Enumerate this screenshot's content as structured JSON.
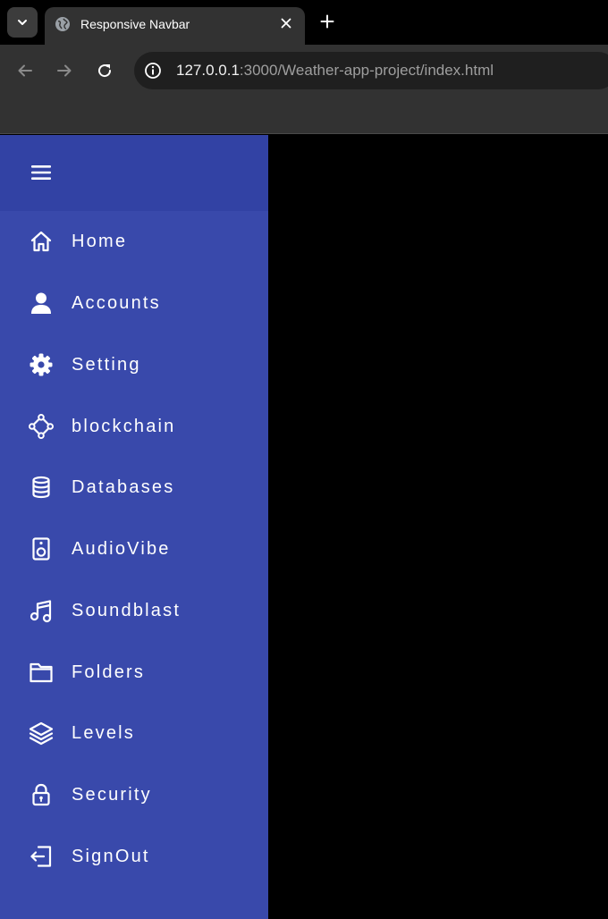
{
  "browser": {
    "tab": {
      "title": "Responsive Navbar",
      "favicon": "globe-icon"
    },
    "address_bar": {
      "host": "127.0.0.1",
      "rest": ":3000/Weather-app-project/index.html"
    },
    "icons": {
      "tab_search": "chevron-down-icon",
      "close_tab": "close-icon",
      "new_tab": "plus-icon",
      "back": "arrow-left-icon",
      "forward": "arrow-right-icon",
      "reload": "reload-icon",
      "site_info": "info-icon"
    }
  },
  "sidebar": {
    "background": "#3949ab",
    "header_background": "#3242a4",
    "toggle_icon": "hamburger-menu-icon",
    "items": [
      {
        "label": "Home",
        "icon": "home-icon"
      },
      {
        "label": "Accounts",
        "icon": "user-icon"
      },
      {
        "label": "Setting",
        "icon": "gear-icon"
      },
      {
        "label": "blockchain",
        "icon": "blockchain-icon"
      },
      {
        "label": "Databases",
        "icon": "database-icon"
      },
      {
        "label": "AudioVibe",
        "icon": "speaker-icon"
      },
      {
        "label": "Soundblast",
        "icon": "music-note-icon"
      },
      {
        "label": "Folders",
        "icon": "folder-icon"
      },
      {
        "label": "Levels",
        "icon": "layers-icon"
      },
      {
        "label": "Security",
        "icon": "lock-icon"
      },
      {
        "label": "SignOut",
        "icon": "sign-out-icon"
      }
    ]
  },
  "content": {
    "background": "#000000"
  }
}
